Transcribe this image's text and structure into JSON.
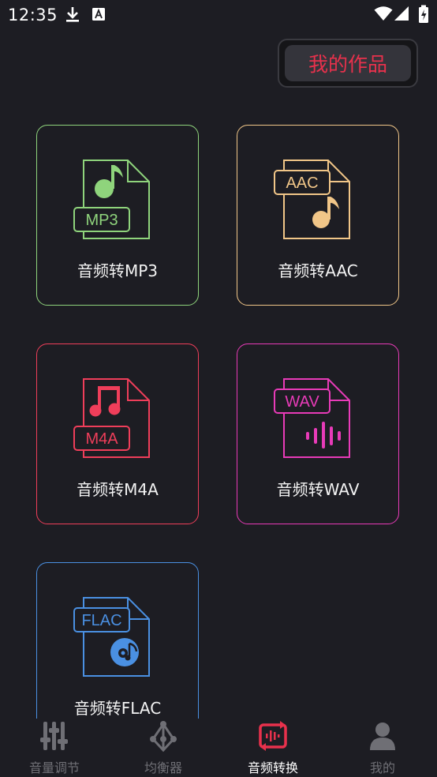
{
  "status": {
    "time": "12:35"
  },
  "header": {
    "my_works_label": "我的作品"
  },
  "converters": [
    {
      "label": "音频转MP3",
      "badge": "MP3",
      "color": "#8fd47c"
    },
    {
      "label": "音频转AAC",
      "badge": "AAC",
      "color": "#f1c688"
    },
    {
      "label": "音频转M4A",
      "badge": "M4A",
      "color": "#ef3e5a"
    },
    {
      "label": "音频转WAV",
      "badge": "WAV",
      "color": "#e83bb8"
    },
    {
      "label": "音频转FLAC",
      "badge": "FLAC",
      "color": "#4a90e2"
    }
  ],
  "nav": [
    {
      "label": "音量调节",
      "icon": "sliders-icon"
    },
    {
      "label": "均衡器",
      "icon": "equalizer-icon"
    },
    {
      "label": "音频转换",
      "icon": "convert-icon",
      "active": true
    },
    {
      "label": "我的",
      "icon": "person-icon"
    }
  ],
  "colors": {
    "accent": "#e8314c",
    "background": "#1d1d23"
  }
}
